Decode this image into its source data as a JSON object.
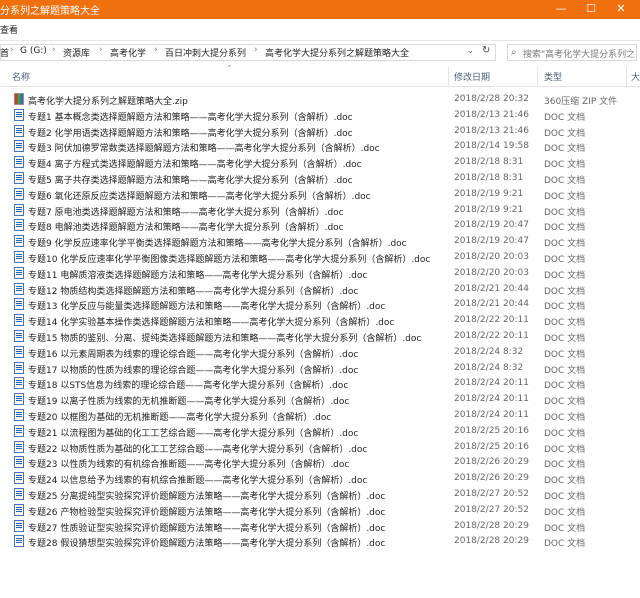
{
  "title_bar": {
    "title": "分系列之解题策略大全",
    "minimize": "—",
    "maximize": "☐",
    "close": "✕"
  },
  "ribbon": {
    "tab": "查看"
  },
  "address": {
    "crumbs": [
      "首",
      "G (G:)",
      "资源库",
      "高考化学",
      "百日冲刺大提分系列",
      "高考化学大提分系列之解题策略大全"
    ],
    "search_placeholder": "搜索\"高考化学大提分系列之..."
  },
  "columns": {
    "name": "名称",
    "date": "修改日期",
    "type": "类型",
    "size": "大"
  },
  "files": [
    {
      "icon": "zip-icon",
      "name": "高考化学大提分系列之解题策略大全.zip",
      "date": "2018/2/28 20:32",
      "type": "360压缩 ZIP 文件",
      "extra": ""
    },
    {
      "icon": "doc-icon",
      "name": "专题1 基本概念类选择题解题方法和策略——高考化学大提分系列（含解析）.doc",
      "date": "2018/2/13 21:46",
      "type": "DOC 文档",
      "extra": ""
    },
    {
      "icon": "doc-icon",
      "name": "专题2 化学用语类选择题解题方法和策略——高考化学大提分系列（含解析）.doc",
      "date": "2018/2/13 21:46",
      "type": "DOC 文档",
      "extra": ""
    },
    {
      "icon": "doc-icon",
      "name": "专题3 阿伏加德罗常数类选择题解题方法和策略——高考化学大提分系列（含解析）.doc",
      "date": "2018/2/14 19:58",
      "type": "DOC 文档",
      "extra": ""
    },
    {
      "icon": "doc-icon",
      "name": "专题4 离子方程式类选择题解题方法和策略——高考化学大提分系列（含解析）.doc",
      "date": "2018/2/18 8:31",
      "type": "DOC 文档",
      "extra": ""
    },
    {
      "icon": "doc-icon",
      "name": "专题5 离子共存类选择题解题方法和策略——高考化学大提分系列（含解析）.doc",
      "date": "2018/2/18 8:31",
      "type": "DOC 文档",
      "extra": ""
    },
    {
      "icon": "doc-icon",
      "name": "专题6 氧化还原反应类选择题解题方法和策略——高考化学大提分系列（含解析）.doc",
      "date": "2018/2/19 9:21",
      "type": "DOC 文档",
      "extra": ""
    },
    {
      "icon": "doc-icon",
      "name": "专题7 原电池类选择题解题方法和策略——高考化学大提分系列（含解析）.doc",
      "date": "2018/2/19 9:21",
      "type": "DOC 文档",
      "extra": ""
    },
    {
      "icon": "doc-icon",
      "name": "专题8 电解池类选择题解题方法和策略——高考化学大提分系列（含解析）.doc",
      "date": "2018/2/19 20:47",
      "type": "DOC 文档",
      "extra": ""
    },
    {
      "icon": "doc-icon",
      "name": "专题9 化学反应速率化学平衡类选择题解题方法和策略——高考化学大提分系列（含解析）.doc",
      "date": "2018/2/19 20:47",
      "type": "DOC 文档",
      "extra": ""
    },
    {
      "icon": "doc-icon",
      "name": "专题10 化学反应速率化学平衡图像类选择题解题方法和策略——高考化学大提分系列（含解析）.doc",
      "date": "2018/2/20 20:03",
      "type": "DOC 文档",
      "extra": ""
    },
    {
      "icon": "doc-icon",
      "name": "专题11 电解质溶液类选择题解题方法和策略——高考化学大提分系列（含解析）.doc",
      "date": "2018/2/20 20:03",
      "type": "DOC 文档",
      "extra": ""
    },
    {
      "icon": "doc-icon",
      "name": "专题12 物质结构类选择题解题方法和策略——高考化学大提分系列（含解析）.doc",
      "date": "2018/2/21 20:44",
      "type": "DOC 文档",
      "extra": ""
    },
    {
      "icon": "doc-icon",
      "name": "专题13 化学反应与能量类选择题解题方法和策略——高考化学大提分系列（含解析）.doc",
      "date": "2018/2/21 20:44",
      "type": "DOC 文档",
      "extra": ""
    },
    {
      "icon": "doc-icon",
      "name": "专题14 化学实验基本操作类选择题解题方法和策略——高考化学大提分系列（含解析）.doc",
      "date": "2018/2/22 20:11",
      "type": "DOC 文档",
      "extra": ""
    },
    {
      "icon": "doc-icon",
      "name": "专题15 物质的鉴别、分离、提纯类选择题解题方法和策略——高考化学大提分系列（含解析）.doc",
      "date": "2018/2/22 20:11",
      "type": "DOC 文档",
      "extra": ""
    },
    {
      "icon": "doc-icon",
      "name": "专题16 以元素周期表为线索的理论综合题——高考化学大提分系列（含解析）.doc",
      "date": "2018/2/24 8:32",
      "type": "DOC 文档",
      "extra": ""
    },
    {
      "icon": "doc-icon",
      "name": "专题17 以物质的性质为线索的理论综合题——高考化学大提分系列（含解析）.doc",
      "date": "2018/2/24 8:32",
      "type": "DOC 文档",
      "extra": ""
    },
    {
      "icon": "doc-icon",
      "name": "专题18 以STS信息为线索的理论综合题——高考化学大提分系列（含解析）.doc",
      "date": "2018/2/24 20:11",
      "type": "DOC 文档",
      "extra": ""
    },
    {
      "icon": "doc-icon",
      "name": "专题19 以离子性质为线索的无机推断题——高考化学大提分系列（含解析）.doc",
      "date": "2018/2/24 20:11",
      "type": "DOC 文档",
      "extra": ""
    },
    {
      "icon": "doc-icon",
      "name": "专题20 以框图为基础的无机推断题——高考化学大提分系列（含解析）.doc",
      "date": "2018/2/24 20:11",
      "type": "DOC 文档",
      "extra": ""
    },
    {
      "icon": "doc-icon",
      "name": "专题21 以流程图为基础的化工工艺综合题——高考化学大提分系列（含解析）.doc",
      "date": "2018/2/25 20:16",
      "type": "DOC 文档",
      "extra": ""
    },
    {
      "icon": "doc-icon",
      "name": "专题22 以物质性质为基础的化工工艺综合题——高考化学大提分系列（含解析）.doc",
      "date": "2018/2/25 20:16",
      "type": "DOC 文档",
      "extra": ""
    },
    {
      "icon": "doc-icon",
      "name": "专题23 以性质为线索的有机综合推断题——高考化学大提分系列（含解析）.doc",
      "date": "2018/2/26 20:29",
      "type": "DOC 文档",
      "extra": ""
    },
    {
      "icon": "doc-icon",
      "name": "专题24 以信息给予为线索的有机综合推断题——高考化学大提分系列（含解析）.doc",
      "date": "2018/2/26 20:29",
      "type": "DOC 文档",
      "extra": ""
    },
    {
      "icon": "doc-icon",
      "name": "专题25 分离提纯型实验探究评价题解题方法策略——高考化学大提分系列（含解析）.doc",
      "date": "2018/2/27 20:52",
      "type": "DOC 文档",
      "extra": ""
    },
    {
      "icon": "doc-icon",
      "name": "专题26 产物检验型实验探究评价题解题方法策略——高考化学大提分系列（含解析）.doc",
      "date": "2018/2/27 20:52",
      "type": "DOC 文档",
      "extra": ""
    },
    {
      "icon": "doc-icon",
      "name": "专题27 性质验证型实验探究评价题解题方法策略——高考化学大提分系列（含解析）.doc",
      "date": "2018/2/28 20:29",
      "type": "DOC 文档",
      "extra": ""
    },
    {
      "icon": "doc-icon",
      "name": "专题28 假设猜想型实验探究评价题解题方法策略——高考化学大提分系列（含解析）.doc",
      "date": "2018/2/28 20:29",
      "type": "DOC 文档",
      "extra": ""
    }
  ]
}
